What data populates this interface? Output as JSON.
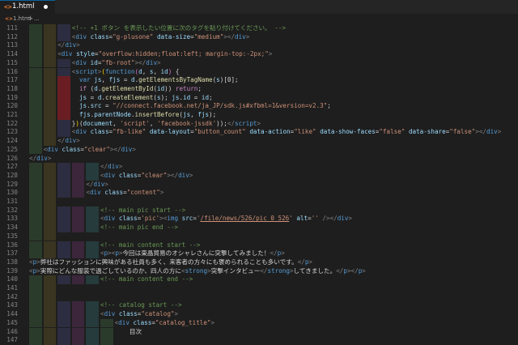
{
  "tab": {
    "label": "1.html"
  },
  "breadcrumb": {
    "file": "1.html",
    "separator": ">",
    "tail": "..."
  },
  "guide_colors": [
    "#2b3b2b",
    "#3a3520",
    "#2c2d40",
    "#3b263b",
    "#263b3b",
    "#2b3b2b"
  ],
  "error_color": "#6a1e23",
  "lines": [
    {
      "n": "111",
      "lvl": 3,
      "segs": [
        [
          "c",
          "<!-- +1 ボタン を表示したい位置に次のタグを貼り付けてください。 -->"
        ]
      ]
    },
    {
      "n": "112",
      "lvl": 3,
      "segs": [
        [
          "g",
          "<"
        ],
        [
          "t",
          "div"
        ],
        [
          "x",
          " "
        ],
        [
          "a",
          "class"
        ],
        [
          "x",
          "="
        ],
        [
          "s",
          "\"g-plusone\""
        ],
        [
          "x",
          " "
        ],
        [
          "a",
          "data-size"
        ],
        [
          "x",
          "="
        ],
        [
          "s",
          "\"medium\""
        ],
        [
          "g",
          ">"
        ],
        [
          "g",
          "</"
        ],
        [
          "t",
          "div"
        ],
        [
          "g",
          ">"
        ]
      ]
    },
    {
      "n": "113",
      "lvl": 2,
      "segs": [
        [
          "g",
          "</"
        ],
        [
          "t",
          "div"
        ],
        [
          "g",
          ">"
        ]
      ]
    },
    {
      "n": "114",
      "lvl": 2,
      "segs": [
        [
          "g",
          "<"
        ],
        [
          "t",
          "div"
        ],
        [
          "x",
          " "
        ],
        [
          "a",
          "style"
        ],
        [
          "x",
          "="
        ],
        [
          "s",
          "\"overflow:hidden;float:left; margin-top:-2px;\""
        ],
        [
          "g",
          ">"
        ]
      ]
    },
    {
      "n": "115",
      "lvl": 3,
      "segs": [
        [
          "g",
          "<"
        ],
        [
          "t",
          "div"
        ],
        [
          "x",
          " "
        ],
        [
          "a",
          "id"
        ],
        [
          "x",
          "="
        ],
        [
          "s",
          "\"fb-root\""
        ],
        [
          "g",
          ">"
        ],
        [
          "g",
          "</"
        ],
        [
          "t",
          "div"
        ],
        [
          "g",
          ">"
        ]
      ]
    },
    {
      "n": "116",
      "lvl": 3,
      "segs": [
        [
          "g",
          "<"
        ],
        [
          "t",
          "script"
        ],
        [
          "g",
          ">"
        ],
        [
          "y",
          "("
        ],
        [
          "t",
          "function"
        ],
        [
          "z",
          "("
        ],
        [
          "v",
          "d"
        ],
        [
          "m",
          ", "
        ],
        [
          "v",
          "s"
        ],
        [
          "m",
          ", "
        ],
        [
          "v",
          "id"
        ],
        [
          "z",
          ")"
        ],
        [
          "m",
          " {"
        ]
      ]
    },
    {
      "n": "117",
      "lvl": 3,
      "err": true,
      "segs": [
        [
          "m",
          "  "
        ],
        [
          "t",
          "var"
        ],
        [
          "m",
          " "
        ],
        [
          "v",
          "js"
        ],
        [
          "m",
          ", "
        ],
        [
          "v",
          "fjs"
        ],
        [
          "m",
          " = "
        ],
        [
          "v",
          "d"
        ],
        [
          "m",
          "."
        ],
        [
          "f",
          "getElementsByTagName"
        ],
        [
          "m",
          "("
        ],
        [
          "v",
          "s"
        ],
        [
          "m",
          ")[0];"
        ]
      ]
    },
    {
      "n": "118",
      "lvl": 3,
      "err": true,
      "segs": [
        [
          "m",
          "  "
        ],
        [
          "k",
          "if"
        ],
        [
          "m",
          " ("
        ],
        [
          "v",
          "d"
        ],
        [
          "m",
          "."
        ],
        [
          "f",
          "getElementById"
        ],
        [
          "m",
          "("
        ],
        [
          "v",
          "id"
        ],
        [
          "m",
          "))"
        ],
        [
          "m",
          " "
        ],
        [
          "k",
          "return"
        ],
        [
          "m",
          ";"
        ]
      ]
    },
    {
      "n": "119",
      "lvl": 3,
      "err": true,
      "segs": [
        [
          "m",
          "  "
        ],
        [
          "v",
          "js"
        ],
        [
          "m",
          " = "
        ],
        [
          "v",
          "d"
        ],
        [
          "m",
          "."
        ],
        [
          "f",
          "createElement"
        ],
        [
          "m",
          "("
        ],
        [
          "v",
          "s"
        ],
        [
          "m",
          "); "
        ],
        [
          "v",
          "js"
        ],
        [
          "m",
          "."
        ],
        [
          "v",
          "id"
        ],
        [
          "m",
          " = "
        ],
        [
          "v",
          "id"
        ],
        [
          "m",
          ";"
        ]
      ]
    },
    {
      "n": "120",
      "lvl": 3,
      "err": true,
      "segs": [
        [
          "m",
          "  "
        ],
        [
          "v",
          "js"
        ],
        [
          "m",
          "."
        ],
        [
          "v",
          "src"
        ],
        [
          "m",
          " = "
        ],
        [
          "s",
          "\"//connect.facebook.net/ja_JP/sdk.js#xfbml=1&version=v2.3\""
        ],
        [
          "m",
          ";"
        ]
      ]
    },
    {
      "n": "121",
      "lvl": 3,
      "err": true,
      "segs": [
        [
          "m",
          "  "
        ],
        [
          "v",
          "fjs"
        ],
        [
          "m",
          "."
        ],
        [
          "v",
          "parentNode"
        ],
        [
          "m",
          "."
        ],
        [
          "f",
          "insertBefore"
        ],
        [
          "m",
          "("
        ],
        [
          "v",
          "js"
        ],
        [
          "m",
          ", "
        ],
        [
          "v",
          "fjs"
        ],
        [
          "m",
          ");"
        ]
      ]
    },
    {
      "n": "122",
      "lvl": 3,
      "segs": [
        [
          "m",
          "}"
        ],
        [
          "y",
          ")"
        ],
        [
          "m",
          "("
        ],
        [
          "v",
          "document"
        ],
        [
          "m",
          ", "
        ],
        [
          "s",
          "'script'"
        ],
        [
          "m",
          ", "
        ],
        [
          "s",
          "'facebook-jssdk'"
        ],
        [
          "m",
          "));"
        ],
        [
          "g",
          "</"
        ],
        [
          "t",
          "script"
        ],
        [
          "g",
          ">"
        ]
      ]
    },
    {
      "n": "123",
      "lvl": 3,
      "segs": [
        [
          "g",
          "<"
        ],
        [
          "t",
          "div"
        ],
        [
          "x",
          " "
        ],
        [
          "a",
          "class"
        ],
        [
          "x",
          "="
        ],
        [
          "s",
          "\"fb-like\""
        ],
        [
          "x",
          " "
        ],
        [
          "a",
          "data-layout"
        ],
        [
          "x",
          "="
        ],
        [
          "s",
          "\"button_count\""
        ],
        [
          "x",
          " "
        ],
        [
          "a",
          "data-action"
        ],
        [
          "x",
          "="
        ],
        [
          "s",
          "\"like\""
        ],
        [
          "x",
          " "
        ],
        [
          "a",
          "data-show-faces"
        ],
        [
          "x",
          "="
        ],
        [
          "s",
          "\"false\""
        ],
        [
          "x",
          " "
        ],
        [
          "a",
          "data-share"
        ],
        [
          "x",
          "="
        ],
        [
          "s",
          "\"false\""
        ],
        [
          "g",
          ">"
        ],
        [
          "g",
          "</"
        ],
        [
          "t",
          "div"
        ],
        [
          "g",
          ">"
        ]
      ]
    },
    {
      "n": "124",
      "lvl": 2,
      "segs": [
        [
          "g",
          "</"
        ],
        [
          "t",
          "div"
        ],
        [
          "g",
          ">"
        ]
      ]
    },
    {
      "n": "125",
      "lvl": 1,
      "segs": [
        [
          "g",
          "<"
        ],
        [
          "t",
          "div"
        ],
        [
          "x",
          " "
        ],
        [
          "a",
          "class"
        ],
        [
          "x",
          "="
        ],
        [
          "s",
          "\"clear\""
        ],
        [
          "g",
          ">"
        ],
        [
          "g",
          "</"
        ],
        [
          "t",
          "div"
        ],
        [
          "g",
          ">"
        ]
      ]
    },
    {
      "n": "126",
      "lvl": 0,
      "segs": [
        [
          "g",
          "</"
        ],
        [
          "t",
          "div"
        ],
        [
          "g",
          ">"
        ]
      ]
    },
    {
      "n": "127",
      "lvl": 5,
      "segs": [
        [
          "g",
          "</"
        ],
        [
          "t",
          "div"
        ],
        [
          "g",
          ">"
        ]
      ]
    },
    {
      "n": "128",
      "lvl": 5,
      "segs": [
        [
          "g",
          "<"
        ],
        [
          "t",
          "div"
        ],
        [
          "x",
          " "
        ],
        [
          "a",
          "class"
        ],
        [
          "x",
          "="
        ],
        [
          "s",
          "\"clear\""
        ],
        [
          "g",
          ">"
        ],
        [
          "g",
          "</"
        ],
        [
          "t",
          "div"
        ],
        [
          "g",
          ">"
        ]
      ]
    },
    {
      "n": "129",
      "lvl": 4,
      "segs": [
        [
          "g",
          "</"
        ],
        [
          "t",
          "div"
        ],
        [
          "g",
          ">"
        ]
      ]
    },
    {
      "n": "130",
      "lvl": 4,
      "segs": [
        [
          "g",
          "<"
        ],
        [
          "t",
          "div"
        ],
        [
          "x",
          " "
        ],
        [
          "a",
          "class"
        ],
        [
          "x",
          "="
        ],
        [
          "s",
          "\"content\""
        ],
        [
          "g",
          ">"
        ]
      ]
    },
    {
      "n": "131",
      "lvl": 2,
      "segs": []
    },
    {
      "n": "132",
      "lvl": 5,
      "segs": [
        [
          "c",
          "<!-- main pic start -->"
        ]
      ]
    },
    {
      "n": "133",
      "lvl": 5,
      "segs": [
        [
          "g",
          "<"
        ],
        [
          "t",
          "div"
        ],
        [
          "x",
          " "
        ],
        [
          "a",
          "class"
        ],
        [
          "x",
          "="
        ],
        [
          "s",
          "'pic'"
        ],
        [
          "g",
          ">"
        ],
        [
          "g",
          "<"
        ],
        [
          "t",
          "img"
        ],
        [
          "x",
          " "
        ],
        [
          "a",
          "src"
        ],
        [
          "x",
          "="
        ],
        [
          "s",
          "'"
        ],
        [
          "u",
          "/file/news/526/pic_0_526"
        ],
        [
          "s",
          "'"
        ],
        [
          "x",
          " "
        ],
        [
          "a",
          "alt"
        ],
        [
          "x",
          "="
        ],
        [
          "s",
          "''"
        ],
        [
          "x",
          " "
        ],
        [
          "g",
          "/>"
        ],
        [
          "g",
          "</"
        ],
        [
          "t",
          "div"
        ],
        [
          "g",
          ">"
        ]
      ]
    },
    {
      "n": "134",
      "lvl": 5,
      "segs": [
        [
          "c",
          "<!-- main pic end -->"
        ]
      ]
    },
    {
      "n": "135",
      "lvl": 2,
      "segs": []
    },
    {
      "n": "136",
      "lvl": 5,
      "segs": [
        [
          "c",
          "<!-- main content start -->"
        ]
      ]
    },
    {
      "n": "137",
      "lvl": 5,
      "segs": [
        [
          "g",
          "<"
        ],
        [
          "t",
          "p"
        ],
        [
          "g",
          ">"
        ],
        [
          "g",
          "<"
        ],
        [
          "t",
          "p"
        ],
        [
          "g",
          ">"
        ],
        [
          "x",
          "今回は東晶貿易のオシャレさんに突撃してみました！"
        ],
        [
          "g",
          "</"
        ],
        [
          "t",
          "p"
        ],
        [
          "g",
          ">"
        ]
      ]
    },
    {
      "n": "138",
      "lvl": 0,
      "segs": [
        [
          "g",
          "<"
        ],
        [
          "t",
          "p"
        ],
        [
          "g",
          ">"
        ],
        [
          "x",
          "弊社はファッションに興味がある社員も多く、来客者の方々にも褒められることも多いです。"
        ],
        [
          "g",
          "</"
        ],
        [
          "t",
          "p"
        ],
        [
          "g",
          ">"
        ]
      ]
    },
    {
      "n": "139",
      "lvl": 0,
      "segs": [
        [
          "g",
          "<"
        ],
        [
          "t",
          "p"
        ],
        [
          "g",
          ">"
        ],
        [
          "x",
          "実際にどんな服装で過ごしているのか、四人の方に"
        ],
        [
          "g",
          "<"
        ],
        [
          "t",
          "strong"
        ],
        [
          "g",
          ">"
        ],
        [
          "x",
          "突撃インタビュー"
        ],
        [
          "g",
          "</"
        ],
        [
          "t",
          "strong"
        ],
        [
          "g",
          ">"
        ],
        [
          "x",
          "してきました。"
        ],
        [
          "g",
          "</"
        ],
        [
          "t",
          "p"
        ],
        [
          "g",
          ">"
        ],
        [
          "g",
          "</"
        ],
        [
          "t",
          "p"
        ],
        [
          "g",
          ">"
        ]
      ]
    },
    {
      "n": "140",
      "lvl": 5,
      "segs": [
        [
          "c",
          "<!-- main content end -->"
        ]
      ]
    },
    {
      "n": "141",
      "lvl": 2,
      "segs": []
    },
    {
      "n": "142",
      "lvl": 2,
      "segs": []
    },
    {
      "n": "143",
      "lvl": 5,
      "segs": [
        [
          "c",
          "<!-- catalog start -->"
        ]
      ]
    },
    {
      "n": "144",
      "lvl": 5,
      "segs": [
        [
          "g",
          "<"
        ],
        [
          "t",
          "div"
        ],
        [
          "x",
          " "
        ],
        [
          "a",
          "class"
        ],
        [
          "x",
          "="
        ],
        [
          "s",
          "\"catalog\""
        ],
        [
          "g",
          ">"
        ]
      ]
    },
    {
      "n": "145",
      "lvl": 6,
      "segs": [
        [
          "g",
          "<"
        ],
        [
          "t",
          "div"
        ],
        [
          "x",
          " "
        ],
        [
          "a",
          "class"
        ],
        [
          "x",
          "="
        ],
        [
          "s",
          "\"catalog_title\""
        ],
        [
          "g",
          ">"
        ]
      ]
    },
    {
      "n": "146",
      "lvl": 6,
      "segs": [
        [
          "x",
          "    目次"
        ]
      ]
    },
    {
      "n": "147",
      "lvl": 6,
      "segs": []
    }
  ]
}
